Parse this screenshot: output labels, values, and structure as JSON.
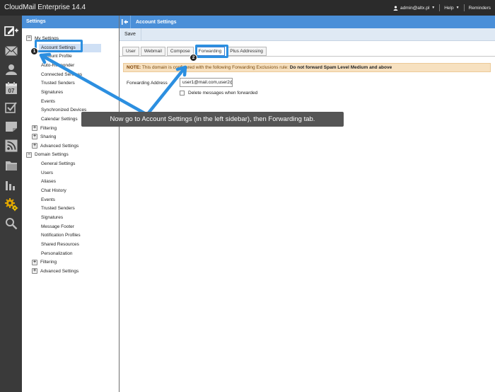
{
  "app": {
    "title": "CloudMail Enterprise 14.4"
  },
  "top": {
    "user": "admin@altx.pl",
    "help": "Help",
    "reminders": "Reminders"
  },
  "iconbar": {
    "items": [
      "compose-icon",
      "mail-icon",
      "contacts-icon",
      "calendar-icon",
      "tasks-icon",
      "notes-icon",
      "rss-icon",
      "files-icon",
      "reports-icon",
      "settings-icon",
      "search-icon"
    ],
    "calendar_day": "07"
  },
  "sidebar": {
    "title": "Settings",
    "tree": [
      {
        "label": "My Settings",
        "toggle": "−",
        "indent": 0
      },
      {
        "label": "Account Settings",
        "indent": 1,
        "selected": true
      },
      {
        "label": "Account Profile",
        "indent": 1
      },
      {
        "label": "Auto-Responder",
        "indent": 1
      },
      {
        "label": "Connected Services",
        "indent": 1
      },
      {
        "label": "Trusted Senders",
        "indent": 1
      },
      {
        "label": "Signatures",
        "indent": 1
      },
      {
        "label": "Events",
        "indent": 1
      },
      {
        "label": "Synchronized Devices",
        "indent": 1
      },
      {
        "label": "Calendar Settings",
        "indent": 1
      },
      {
        "label": "Filtering",
        "toggle": "+",
        "indent": 0.5
      },
      {
        "label": "Sharing",
        "toggle": "+",
        "indent": 0.5
      },
      {
        "label": "Advanced Settings",
        "toggle": "+",
        "indent": 0.5
      },
      {
        "label": "Domain Settings",
        "toggle": "−",
        "indent": 0
      },
      {
        "label": "General Settings",
        "indent": 1
      },
      {
        "label": "Users",
        "indent": 1
      },
      {
        "label": "Aliases",
        "indent": 1
      },
      {
        "label": "Chat History",
        "indent": 1
      },
      {
        "label": "Events",
        "indent": 1
      },
      {
        "label": "Trusted Senders",
        "indent": 1
      },
      {
        "label": "Signatures",
        "indent": 1
      },
      {
        "label": "Message Footer",
        "indent": 1
      },
      {
        "label": "Notification Profiles",
        "indent": 1
      },
      {
        "label": "Shared Resources",
        "indent": 1
      },
      {
        "label": "Personalization",
        "indent": 1
      },
      {
        "label": "Filtering",
        "toggle": "+",
        "indent": 0.5
      },
      {
        "label": "Advanced Settings",
        "toggle": "+",
        "indent": 0.5
      }
    ]
  },
  "main": {
    "title": "Account Settings",
    "save_label": "Save",
    "tabs": [
      {
        "label": "User"
      },
      {
        "label": "Webmail"
      },
      {
        "label": "Compose"
      },
      {
        "label": "Forwarding",
        "active": true
      },
      {
        "label": "Plus Addressing"
      }
    ],
    "note": {
      "prefix": "NOTE:",
      "text": " This domain is configured with the following Forwarding Exclusions rule: ",
      "rule": "Do not forward Spam Level Medium and above"
    },
    "forwarding_label": "Forwarding Address",
    "forwarding_value": "user1@mail.com,user2@",
    "delete_label": "Delete messages when forwarded"
  },
  "overlay": {
    "tooltip": "Now go to Account Settings (in the left sidebar), then Forwarding tab.",
    "step1": "1",
    "step2": "2",
    "accent": "#2c8fe0"
  }
}
